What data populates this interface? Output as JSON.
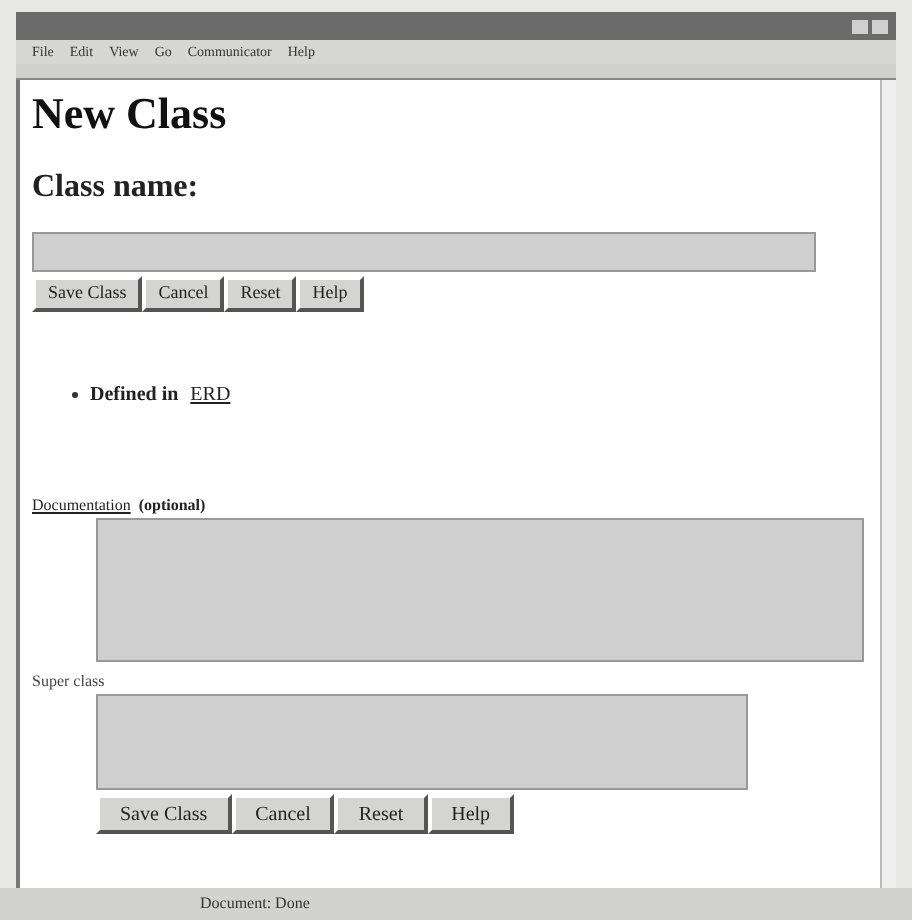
{
  "menu": [
    "File",
    "Edit",
    "View",
    "Go",
    "Communicator",
    "Help"
  ],
  "heading": "New Class",
  "class_name_label": "Class name:",
  "buttons_top": [
    "Save Class",
    "Cancel",
    "Reset",
    "Help"
  ],
  "bullets": [
    {
      "text": "Defined in",
      "link": "ERD"
    }
  ],
  "documentation": {
    "link": "Documentation",
    "label": "(optional)"
  },
  "superclass_label": "Super class",
  "buttons_bottom": [
    "Save Class",
    "Cancel",
    "Reset",
    "Help"
  ],
  "status_bar": "Document: Done"
}
